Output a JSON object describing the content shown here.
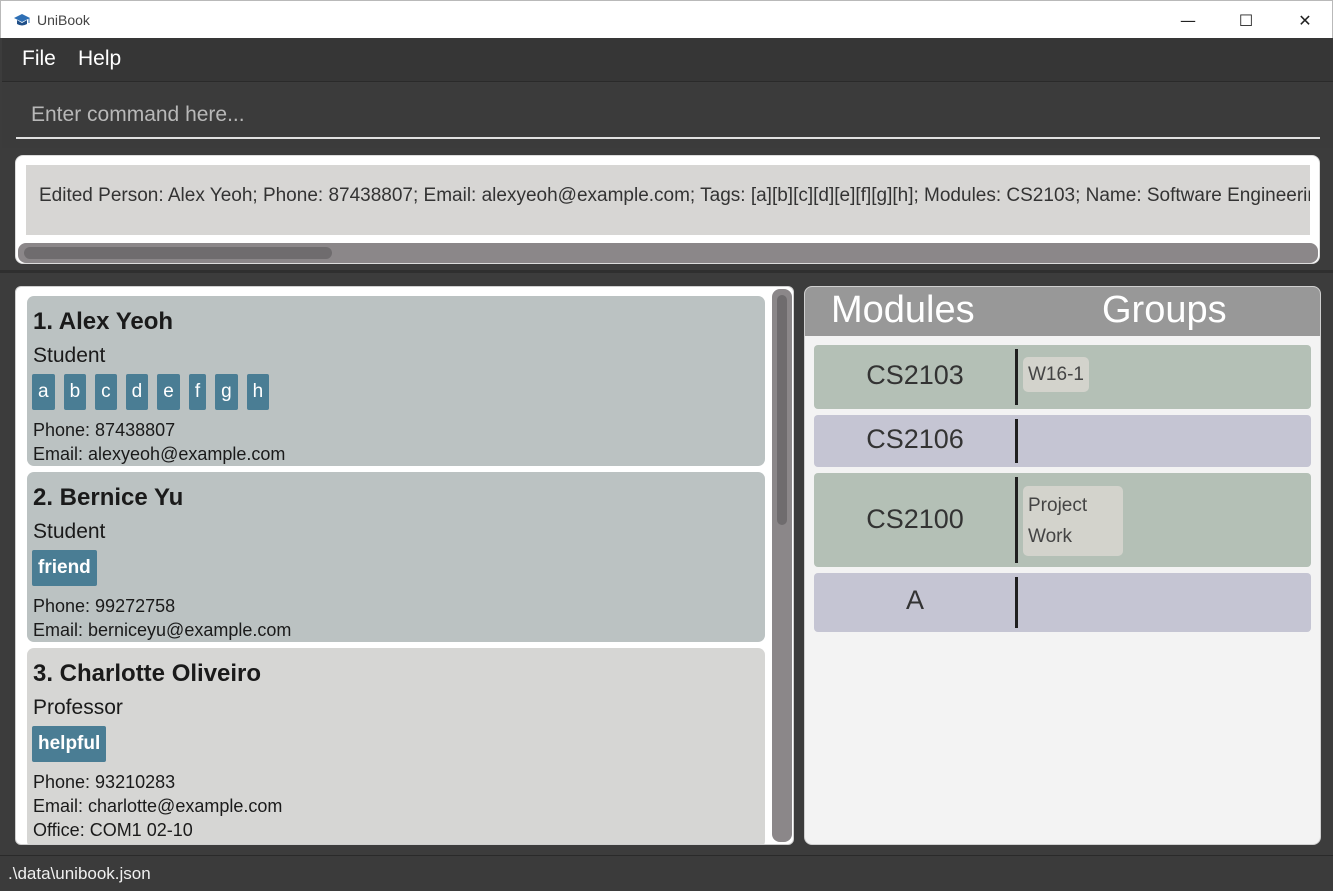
{
  "window": {
    "title": "UniBook",
    "min_glyph": "—",
    "max_glyph": "☐",
    "close_glyph": "✕"
  },
  "menu": {
    "file": "File",
    "help": "Help"
  },
  "command": {
    "placeholder": "Enter command here..."
  },
  "result": {
    "text": "Edited Person: Alex Yeoh; Phone: 87438807; Email: alexyeoh@example.com; Tags: [a][b][c][d][e][f][g][h]; Modules: CS2103; Name: Software Engineering"
  },
  "persons": [
    {
      "name": "1.  Alex Yeoh",
      "role": "Student",
      "tags": [
        "a",
        "b",
        "c",
        "d",
        "e",
        "f",
        "g",
        "h"
      ],
      "phone": "Phone: 87438807",
      "email": "Email: alexyeoh@example.com"
    },
    {
      "name": "2.  Bernice Yu",
      "role": "Student",
      "tags": [
        "friend"
      ],
      "phone": "Phone: 99272758",
      "email": "Email: berniceyu@example.com"
    },
    {
      "name": "3.  Charlotte Oliveiro",
      "role": "Professor",
      "tags": [
        "helpful"
      ],
      "phone": "Phone: 93210283",
      "email": "Email: charlotte@example.com",
      "office": "Office: COM1 02-10"
    }
  ],
  "modules_panel": {
    "header_modules": "Modules",
    "header_groups": "Groups",
    "rows": [
      {
        "code": "CS2103",
        "groups": [
          "W16-1"
        ]
      },
      {
        "code": "CS2106",
        "groups": []
      },
      {
        "code": "CS2100",
        "groups": [
          "Project Work"
        ]
      },
      {
        "code": "A",
        "groups": []
      }
    ]
  },
  "status": {
    "path": ".\\data\\unibook.json"
  },
  "colors": {
    "tag": "#4a7d94",
    "card_selected": "#bbc2c2",
    "card_default": "#d6d6d4",
    "module_green": "#b4c0b6",
    "module_lavender": "#c5c5d3"
  }
}
